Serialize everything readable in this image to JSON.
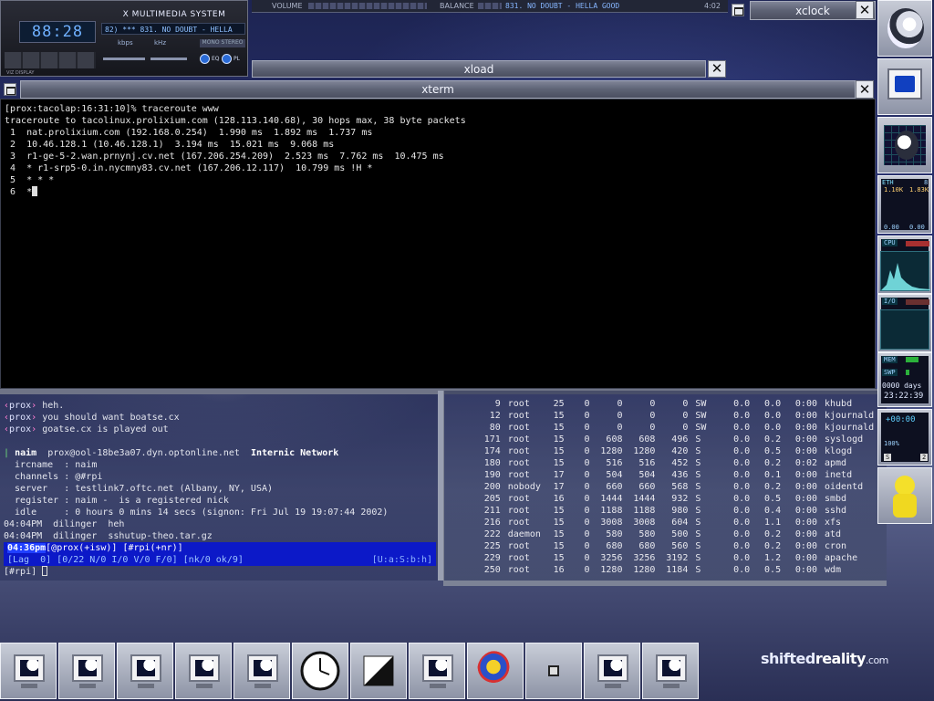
{
  "xmms": {
    "title": "X MULTIMEDIA SYSTEM",
    "time": "88:28",
    "song": "82)  ***  831. NO DOUBT - HELLA",
    "kbps": "kbps",
    "khz": "kHz",
    "stereo": "MONO  STEREO",
    "eq": "EQ",
    "pl": "PL",
    "viz_label": "VIZ DISPLAY"
  },
  "top_strip": {
    "volume": "VOLUME",
    "balance": "BALANCE",
    "song": "831. NO DOUBT - HELLA GOOD",
    "time": "4:02"
  },
  "windows": {
    "xclock": "xclock",
    "xload": "xload",
    "xterm": "xterm",
    "close": "✕"
  },
  "xterm": {
    "lines": [
      "[prox:tacolap:16:31:10]% traceroute www",
      "traceroute to tacolinux.prolixium.com (128.113.140.68), 30 hops max, 38 byte packets",
      " 1  nat.prolixium.com (192.168.0.254)  1.990 ms  1.892 ms  1.737 ms",
      " 2  10.46.128.1 (10.46.128.1)  3.194 ms  15.021 ms  9.068 ms",
      " 3  r1-ge-5-2.wan.prnynj.cv.net (167.206.254.209)  2.523 ms  7.762 ms  10.475 ms",
      " 4  * r1-srp5-0.in.nycmny83.cv.net (167.206.12.117)  10.799 ms !H *",
      " 5  * * *",
      " 6  *"
    ]
  },
  "irc": {
    "chat": [
      {
        "nick": "prox",
        "msg": "heh."
      },
      {
        "nick": "prox",
        "msg": "you should want boatse.cx"
      },
      {
        "nick": "prox",
        "msg": "goatse.cx is played out"
      }
    ],
    "whois_head_nick": "naim",
    "whois_head_host": "prox@ool-18be3a07.dyn.optonline.net",
    "whois_head_net": "Internic Network",
    "whois": [
      "  ircname  : naim",
      "  channels : @#rpi",
      "  server   : testlink7.oftc.net (Albany, NY, USA)",
      "  register : naim -  is a registered nick",
      "  idle     : 0 hours 0 mins 14 secs (signon: Fri Jul 19 19:07:44 2002)"
    ],
    "log": [
      "04:04PM  dilinger  heh",
      "04:04PM  dilinger  sshutup-theo.tar.gz"
    ],
    "status_time": "04:36pm",
    "status_rest": "[@prox(+isw)] [#rpi(+nr)]",
    "status2": "[Lag  0] [0/22 N/0 I/0 V/0 F/0] [nk/0 ok/9]",
    "status2_right": "[U:a:S:b:h]",
    "input": "[#rpi] "
  },
  "top": {
    "rows": [
      [
        "9",
        "root",
        "25",
        "0",
        "0",
        "0",
        "0",
        "SW",
        "0.0",
        "0.0",
        "0:00",
        "khubd"
      ],
      [
        "12",
        "root",
        "15",
        "0",
        "0",
        "0",
        "0",
        "SW",
        "0.0",
        "0.0",
        "0:00",
        "kjournald"
      ],
      [
        "80",
        "root",
        "15",
        "0",
        "0",
        "0",
        "0",
        "SW",
        "0.0",
        "0.0",
        "0:00",
        "kjournald"
      ],
      [
        "171",
        "root",
        "15",
        "0",
        "608",
        "608",
        "496",
        "S",
        "0.0",
        "0.2",
        "0:00",
        "syslogd"
      ],
      [
        "174",
        "root",
        "15",
        "0",
        "1280",
        "1280",
        "420",
        "S",
        "0.0",
        "0.5",
        "0:00",
        "klogd"
      ],
      [
        "180",
        "root",
        "15",
        "0",
        "516",
        "516",
        "452",
        "S",
        "0.0",
        "0.2",
        "0:02",
        "apmd"
      ],
      [
        "190",
        "root",
        "17",
        "0",
        "504",
        "504",
        "436",
        "S",
        "0.0",
        "0.1",
        "0:00",
        "inetd"
      ],
      [
        "200",
        "nobody",
        "17",
        "0",
        "660",
        "660",
        "568",
        "S",
        "0.0",
        "0.2",
        "0:00",
        "oidentd"
      ],
      [
        "205",
        "root",
        "16",
        "0",
        "1444",
        "1444",
        "932",
        "S",
        "0.0",
        "0.5",
        "0:00",
        "smbd"
      ],
      [
        "211",
        "root",
        "15",
        "0",
        "1188",
        "1188",
        "980",
        "S",
        "0.0",
        "0.4",
        "0:00",
        "sshd"
      ],
      [
        "216",
        "root",
        "15",
        "0",
        "3008",
        "3008",
        "604",
        "S",
        "0.0",
        "1.1",
        "0:00",
        "xfs"
      ],
      [
        "222",
        "daemon",
        "15",
        "0",
        "580",
        "580",
        "500",
        "S",
        "0.0",
        "0.2",
        "0:00",
        "atd"
      ],
      [
        "225",
        "root",
        "15",
        "0",
        "680",
        "680",
        "560",
        "S",
        "0.0",
        "0.2",
        "0:00",
        "cron"
      ],
      [
        "229",
        "root",
        "15",
        "0",
        "3256",
        "3256",
        "3192",
        "S",
        "0.0",
        "1.2",
        "0:00",
        "apache"
      ],
      [
        "250",
        "root",
        "16",
        "0",
        "1280",
        "1280",
        "1184",
        "S",
        "0.0",
        "0.5",
        "0:00",
        "wdm"
      ]
    ]
  },
  "dock": {
    "eth_label": "ETH",
    "eth_num": "8",
    "eth_in": "1.10K",
    "eth_out": "1.83K",
    "eth_in2": "0.00",
    "eth_out2": "0.00",
    "cpu": "CPU",
    "io": "I/O",
    "mem": "MEM",
    "swp": "SWP",
    "uptime_days": "0000 days",
    "uptime_time": "23:22:39",
    "timer": "+00:00",
    "timer_pct": "100%",
    "timer_s": "S",
    "timer_2": "2"
  },
  "brand": {
    "prefix": "shifted",
    "name": "reality",
    "domain": ".com"
  },
  "colors": {
    "irc_status": "#0c19c8",
    "graph": "#0b2a36"
  }
}
